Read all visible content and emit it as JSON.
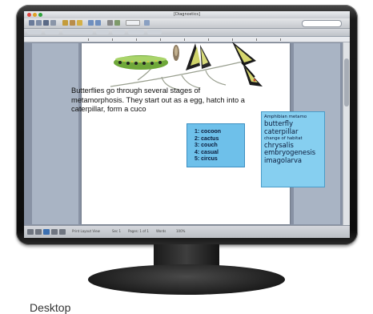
{
  "window": {
    "title": "[Diagnostics]"
  },
  "toolbar": {
    "search_placeholder": "",
    "ribbon_tabs": [
      "Home",
      "Layout",
      "Document Elements",
      "Tables",
      "Charts",
      "SmartArt",
      "Review"
    ]
  },
  "document": {
    "paragraph": "Butterflies go through several stages of metamorphosis.  They start out as a egg, hatch into a caterpillar, form a cuco",
    "choices": [
      "1: cocoon",
      "2: cactus",
      "3: couch",
      "4: casual",
      "5: circus"
    ],
    "word_bank": [
      {
        "text": "Amphibian metamo",
        "size": "small"
      },
      {
        "text": "butterfly",
        "size": "big"
      },
      {
        "text": "caterpillar",
        "size": "big"
      },
      {
        "text": "change of habitat",
        "size": "small"
      },
      {
        "text": "chrysalis",
        "size": "big"
      },
      {
        "text": "embryogenesis",
        "size": "big"
      },
      {
        "text": "imagolarva",
        "size": "big"
      }
    ]
  },
  "statusbar": {
    "items": [
      "Print Layout View",
      "Sec 1",
      "Pages: 1 of 1",
      "Words",
      "100%"
    ]
  },
  "caption": {
    "text": "Desktop"
  },
  "colors": {
    "choice_box": "#6ec0ea",
    "word_bank_box": "#86cff0",
    "bezel": "#111111"
  }
}
